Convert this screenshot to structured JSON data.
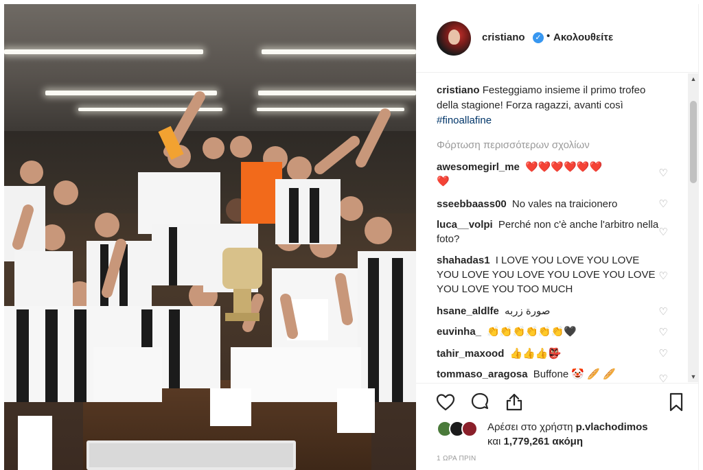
{
  "post": {
    "username": "cristiano",
    "verified_icon": "verified-badge-icon",
    "separator": "•",
    "follow_label": "Ακολουθείτε"
  },
  "caption": {
    "username": "cristiano",
    "text": "Festeggiamo insieme il primo trofeo della stagione! Forza ragazzi, avanti così",
    "hashtag": "#finoallafine"
  },
  "load_more": "Φόρτωση περισσότερων σχολίων",
  "comments": [
    {
      "user": "awesomegirl_me",
      "text": "❤️❤️❤️❤️❤️❤️\n❤️"
    },
    {
      "user": "sseebbaass00",
      "text": "No vales na traicionero"
    },
    {
      "user": "luca__volpi",
      "text": "Perché non c'è anche l'arbitro nella foto?"
    },
    {
      "user": "shahadas1",
      "text": "I LOVE YOU LOVE YOU LOVE YOU LOVE YOU LOVE YOU LOVE YOU LOVE YOU LOVE YOU TOO MUCH"
    },
    {
      "user": "hsane_aldlfe",
      "text": "صورة زربه"
    },
    {
      "user": "euvinha_",
      "text": "👏👏👏👏👏👏🖤"
    },
    {
      "user": "tahir_maxood",
      "text": "👍👍👍👺"
    },
    {
      "user": "tommaso_aragosa",
      "text": "Buffone 🤡 🥖 🥖"
    }
  ],
  "likes": {
    "prefix": "Αρέσει στο χρήστη",
    "user": "p.vlachodimos",
    "and": "και",
    "count": "1,779,261",
    "suffix": "ακόμη"
  },
  "timestamp": "1 ΩΡΑ ΠΡΙΝ",
  "colors": {
    "link": "#003569",
    "verified": "#3897f0",
    "secondary_text": "#999999",
    "text": "#262626",
    "heart": "#ed4956"
  }
}
